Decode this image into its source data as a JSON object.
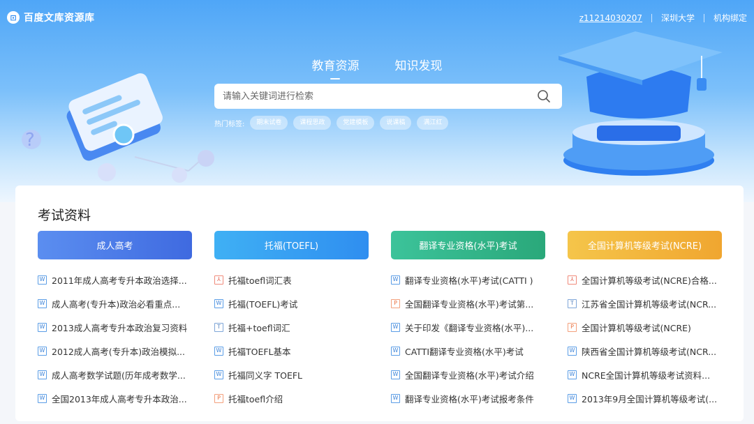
{
  "brand": {
    "logo_text": "百度文库资源库",
    "logo_mark": "⊡"
  },
  "topbar": {
    "user": "z11214030207",
    "school": "深圳大学",
    "bind": "机构绑定"
  },
  "tabs": [
    {
      "label": "教育资源",
      "active": true
    },
    {
      "label": "知识发现",
      "active": false
    }
  ],
  "search": {
    "placeholder": "请输入关键词进行检索",
    "value": "",
    "icon": "search-icon"
  },
  "hot": {
    "label": "热门标签:",
    "tags": [
      "期末试卷",
      "课程思政",
      "党建模板",
      "说课稿",
      "满江红"
    ]
  },
  "section": {
    "title": "考试资料",
    "columns": [
      {
        "title": "成人高考",
        "color": "#4a7bea",
        "items": [
          {
            "type": "W",
            "text": "2011年成人高考专升本政治选择..."
          },
          {
            "type": "W",
            "text": "成人高考(专升本)政治必看重点..."
          },
          {
            "type": "W",
            "text": "2013成人高考专升本政治复习资料"
          },
          {
            "type": "W",
            "text": "2012成人高考(专升本)政治模拟..."
          },
          {
            "type": "W",
            "text": "成人高考数学试题(历年成考数学..."
          },
          {
            "type": "W",
            "text": "全国2013年成人高考专升本政治..."
          }
        ]
      },
      {
        "title": "托福(TOEFL)",
        "color": "#3aa4f0",
        "items": [
          {
            "type": "PDF",
            "text": "托福toefl词汇表"
          },
          {
            "type": "W",
            "text": "托福(TOEFL)考试"
          },
          {
            "type": "T",
            "text": "托福+toefl词汇"
          },
          {
            "type": "W",
            "text": "托福TOEFL基本"
          },
          {
            "type": "W",
            "text": "托福同义字 TOEFL"
          },
          {
            "type": "P",
            "text": "托福toefl介绍"
          }
        ]
      },
      {
        "title": "翻译专业资格(水平)考试",
        "color": "#35b98a",
        "items": [
          {
            "type": "W",
            "text": "翻译专业资格(水平)考试(CATTI )"
          },
          {
            "type": "P",
            "text": "全国翻译专业资格(水平)考试第..."
          },
          {
            "type": "W",
            "text": "关于印发《翻译专业资格(水平)..."
          },
          {
            "type": "W",
            "text": "CATTI翻译专业资格(水平)考试"
          },
          {
            "type": "W",
            "text": "全国翻译专业资格(水平)考试介绍"
          },
          {
            "type": "W",
            "text": "翻译专业资格(水平)考试报考条件"
          }
        ]
      },
      {
        "title": "全国计算机等级考试(NCRE)",
        "color": "#f2b43a",
        "items": [
          {
            "type": "PDF",
            "text": "全国计算机等级考试(NCRE)合格..."
          },
          {
            "type": "T",
            "text": "江苏省全国计算机等级考试(NCR..."
          },
          {
            "type": "P",
            "text": "全国计算机等级考试(NCRE)"
          },
          {
            "type": "W",
            "text": "陕西省全国计算机等级考试(NCR..."
          },
          {
            "type": "W",
            "text": "NCRE全国计算机等级考试资料..."
          },
          {
            "type": "W",
            "text": "2013年9月全国计算机等级考试(..."
          }
        ]
      }
    ]
  }
}
